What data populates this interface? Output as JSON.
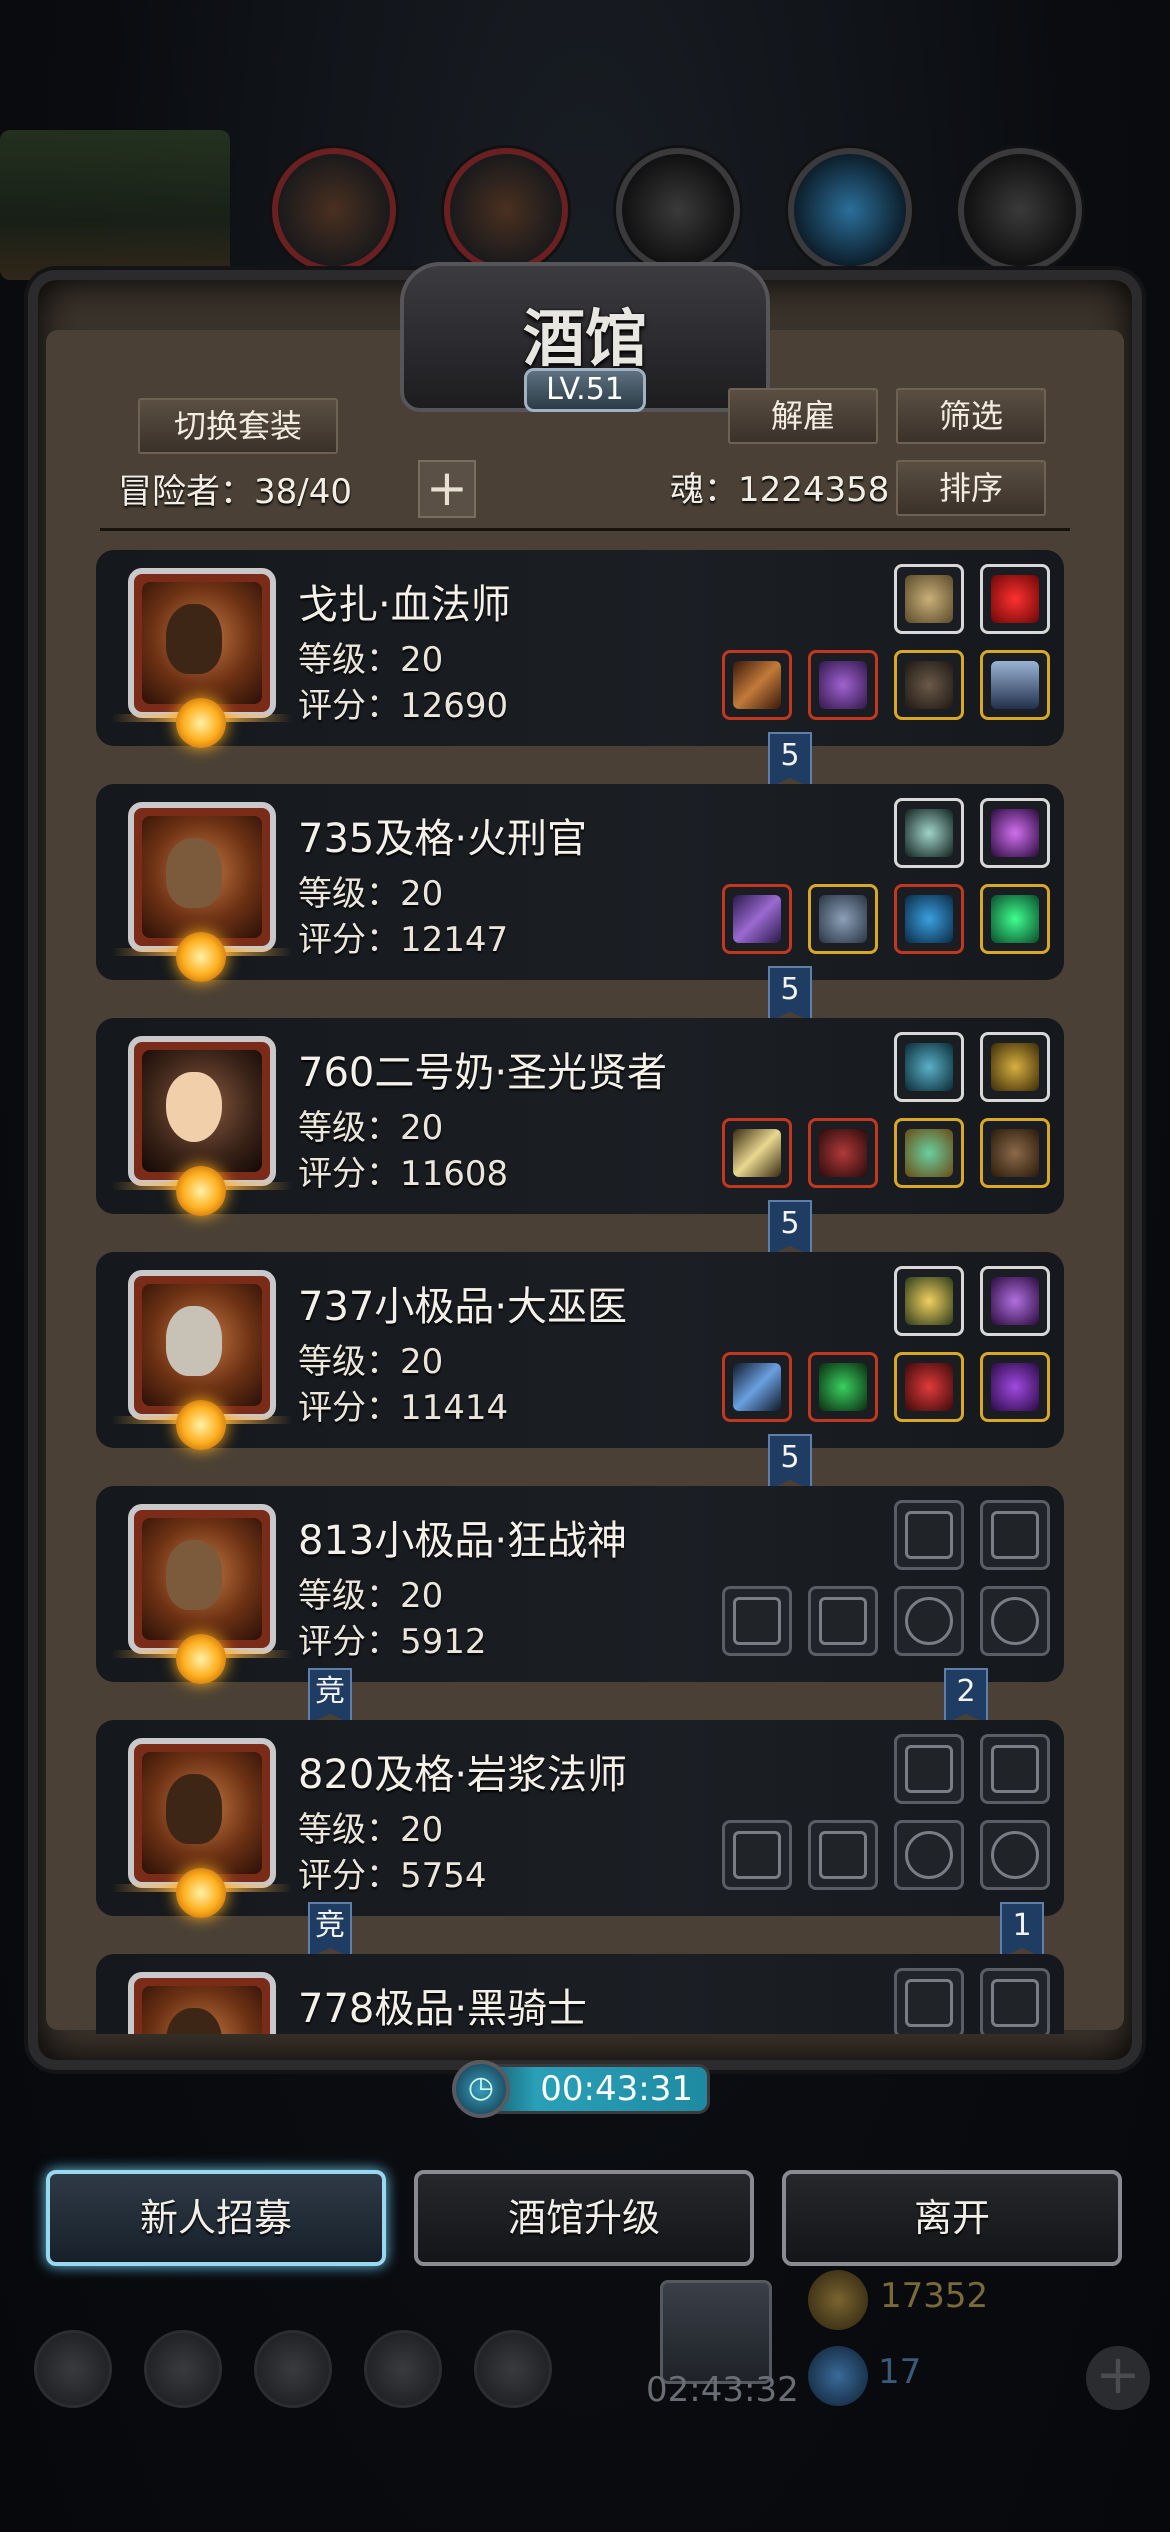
{
  "panel": {
    "title": "酒馆",
    "level": "LV.51",
    "switch_outfit": "切换套装",
    "dismiss": "解雇",
    "filter": "筛选",
    "sort": "排序",
    "adventurers_label": "冒险者：38/40",
    "soul_label": "魂：1224358",
    "add_icon": "plus-icon"
  },
  "heroes": [
    {
      "name": "戈扎·血法师",
      "level": "等级：20",
      "score": "评分：12690",
      "badge": "5"
    },
    {
      "name": "735及格·火刑官",
      "level": "等级：20",
      "score": "评分：12147",
      "badge": "5"
    },
    {
      "name": "760二号奶·圣光贤者",
      "level": "等级：20",
      "score": "评分：11608",
      "badge": "5"
    },
    {
      "name": "737小极品·大巫医",
      "level": "等级：20",
      "score": "评分：11414",
      "badge": "5"
    },
    {
      "name": "813小极品·狂战神",
      "level": "等级：20",
      "score": "评分：5912",
      "badge_left": "竞",
      "badge": "2"
    },
    {
      "name": "820及格·岩浆法师",
      "level": "等级：20",
      "score": "评分：5754",
      "badge_left": "竞",
      "badge": "1"
    },
    {
      "name": "778极品·黑骑士"
    }
  ],
  "timer": "00:43:31",
  "buttons": {
    "recruit": "新人招募",
    "upgrade": "酒馆升级",
    "leave": "离开"
  },
  "bottom": {
    "gift_timer": "02:43:32",
    "gold": "17352",
    "gems": "17"
  }
}
